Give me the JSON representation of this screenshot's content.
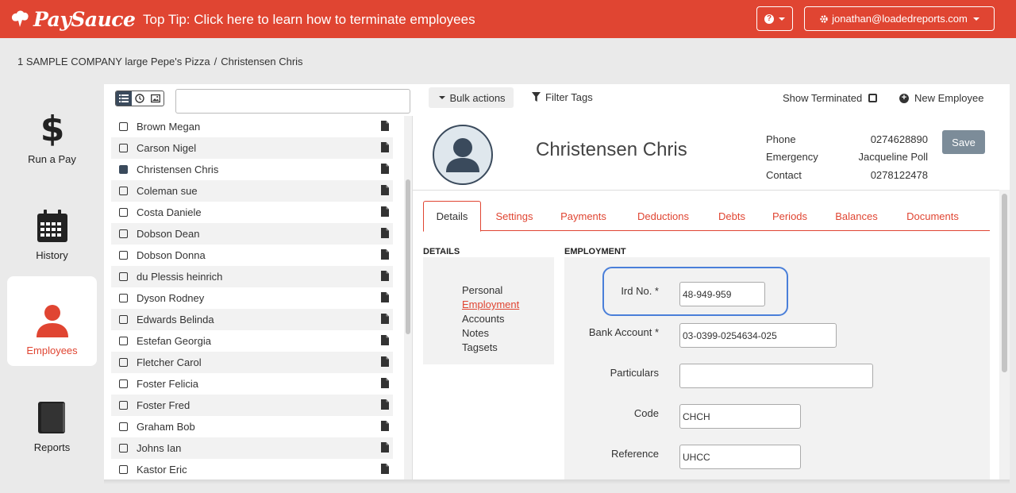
{
  "brand": {
    "name": "PaySauce",
    "color": "#e04532"
  },
  "top_tip": "Top Tip: Click here to learn how to terminate employees",
  "user_menu": {
    "email": "jonathan@loadedreports.com"
  },
  "breadcrumb": {
    "company": "1 SAMPLE COMPANY large Pepe's Pizza",
    "separator": "/",
    "current": "Christensen Chris"
  },
  "leftnav": {
    "run_pay": "Run a Pay",
    "history": "History",
    "employees": "Employees",
    "reports": "Reports"
  },
  "toolbar": {
    "search_placeholder": "",
    "bulk_actions": "Bulk actions",
    "filter_tags": "Filter Tags",
    "show_terminated": "Show Terminated",
    "new_employee": "New Employee"
  },
  "employees": [
    {
      "name": "Brown Megan",
      "checked": false
    },
    {
      "name": "Carson Nigel",
      "checked": false
    },
    {
      "name": "Christensen Chris",
      "checked": true
    },
    {
      "name": "Coleman sue",
      "checked": false
    },
    {
      "name": "Costa Daniele",
      "checked": false
    },
    {
      "name": "Dobson Dean",
      "checked": false
    },
    {
      "name": "Dobson Donna",
      "checked": false
    },
    {
      "name": "du Plessis heinrich",
      "checked": false
    },
    {
      "name": "Dyson Rodney",
      "checked": false
    },
    {
      "name": "Edwards Belinda",
      "checked": false
    },
    {
      "name": "Estefan Georgia",
      "checked": false
    },
    {
      "name": "Fletcher Carol",
      "checked": false
    },
    {
      "name": "Foster Felicia",
      "checked": false
    },
    {
      "name": "Foster Fred",
      "checked": false
    },
    {
      "name": "Graham Bob",
      "checked": false
    },
    {
      "name": "Johns Ian",
      "checked": false
    },
    {
      "name": "Kastor Eric",
      "checked": false
    }
  ],
  "employee": {
    "name": "Christensen Chris",
    "contact": {
      "phone_label": "Phone",
      "phone": "0274628890",
      "emergency_label": "Emergency",
      "emergency": "Jacqueline Poll",
      "contact_label": "Contact",
      "contact": "0278122478"
    },
    "save_label": "Save"
  },
  "tabs": [
    "Details",
    "Settings",
    "Payments",
    "Deductions",
    "Debts",
    "Periods",
    "Balances",
    "Documents"
  ],
  "details_section": {
    "title": "DETAILS",
    "items": [
      "Personal",
      "Employment",
      "Accounts",
      "Notes",
      "Tagsets"
    ],
    "active": "Employment"
  },
  "employment": {
    "title": "EMPLOYMENT",
    "ird_label": "Ird No. *",
    "ird": "48-949-959",
    "bank_label": "Bank Account *",
    "bank": "03-0399-0254634-025",
    "particulars_label": "Particulars",
    "particulars": "",
    "code_label": "Code",
    "code": "CHCH",
    "reference_label": "Reference",
    "reference": "UHCC"
  }
}
